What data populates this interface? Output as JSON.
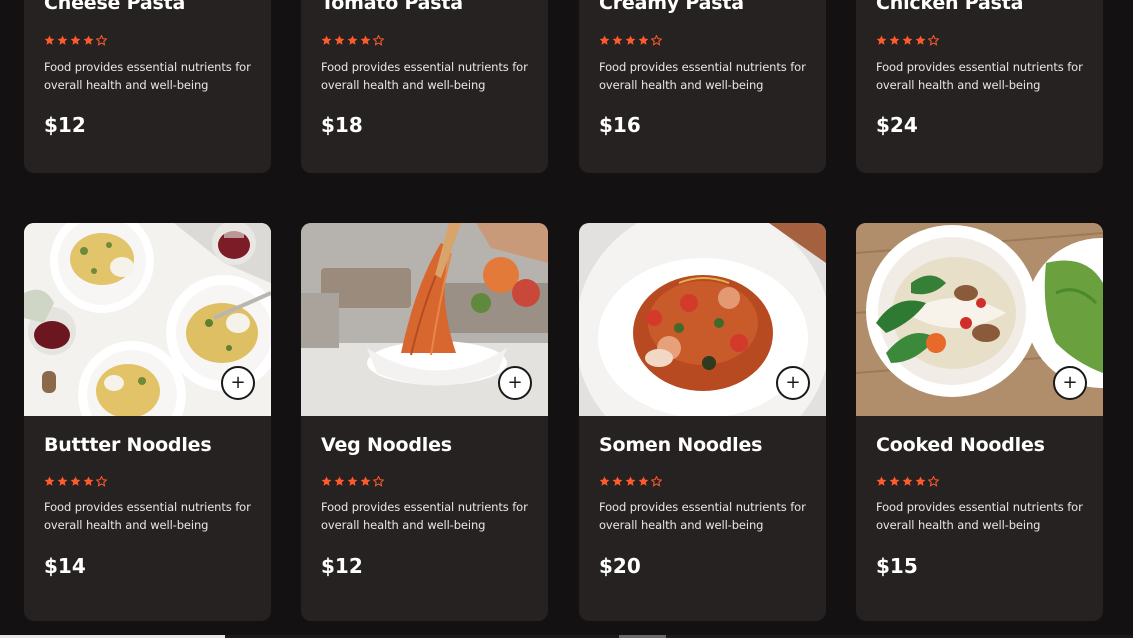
{
  "top_row": [
    {
      "title": "Cheese Pasta",
      "rating": 4,
      "description": "Food provides essential nutrients for overall health and well-being",
      "price": "$12"
    },
    {
      "title": "Tomato Pasta",
      "rating": 4,
      "description": "Food provides essential nutrients for overall health and well-being",
      "price": "$18"
    },
    {
      "title": "Creamy Pasta",
      "rating": 4,
      "description": "Food provides essential nutrients for overall health and well-being",
      "price": "$16"
    },
    {
      "title": "Chicken Pasta",
      "rating": 4,
      "description": "Food provides essential nutrients for overall health and well-being",
      "price": "$24"
    }
  ],
  "bottom_row": [
    {
      "title": "Buttter Noodles",
      "rating": 4,
      "description": "Food provides essential nutrients for overall health and well-being",
      "price": "$14",
      "add_label": "+"
    },
    {
      "title": "Veg Noodles",
      "rating": 4,
      "description": "Food provides essential nutrients for overall health and well-being",
      "price": "$12",
      "add_label": "+"
    },
    {
      "title": "Somen Noodles",
      "rating": 4,
      "description": "Food provides essential nutrients for overall health and well-being",
      "price": "$20",
      "add_label": "+"
    },
    {
      "title": "Cooked Noodles",
      "rating": 4,
      "description": "Food provides essential nutrients for overall health and well-being",
      "price": "$15",
      "add_label": "+"
    }
  ],
  "max_rating": 5,
  "colors": {
    "page_bg": "#131112",
    "card_bg": "#262221",
    "star": "#ff5a2c",
    "text": "#ffffff"
  }
}
